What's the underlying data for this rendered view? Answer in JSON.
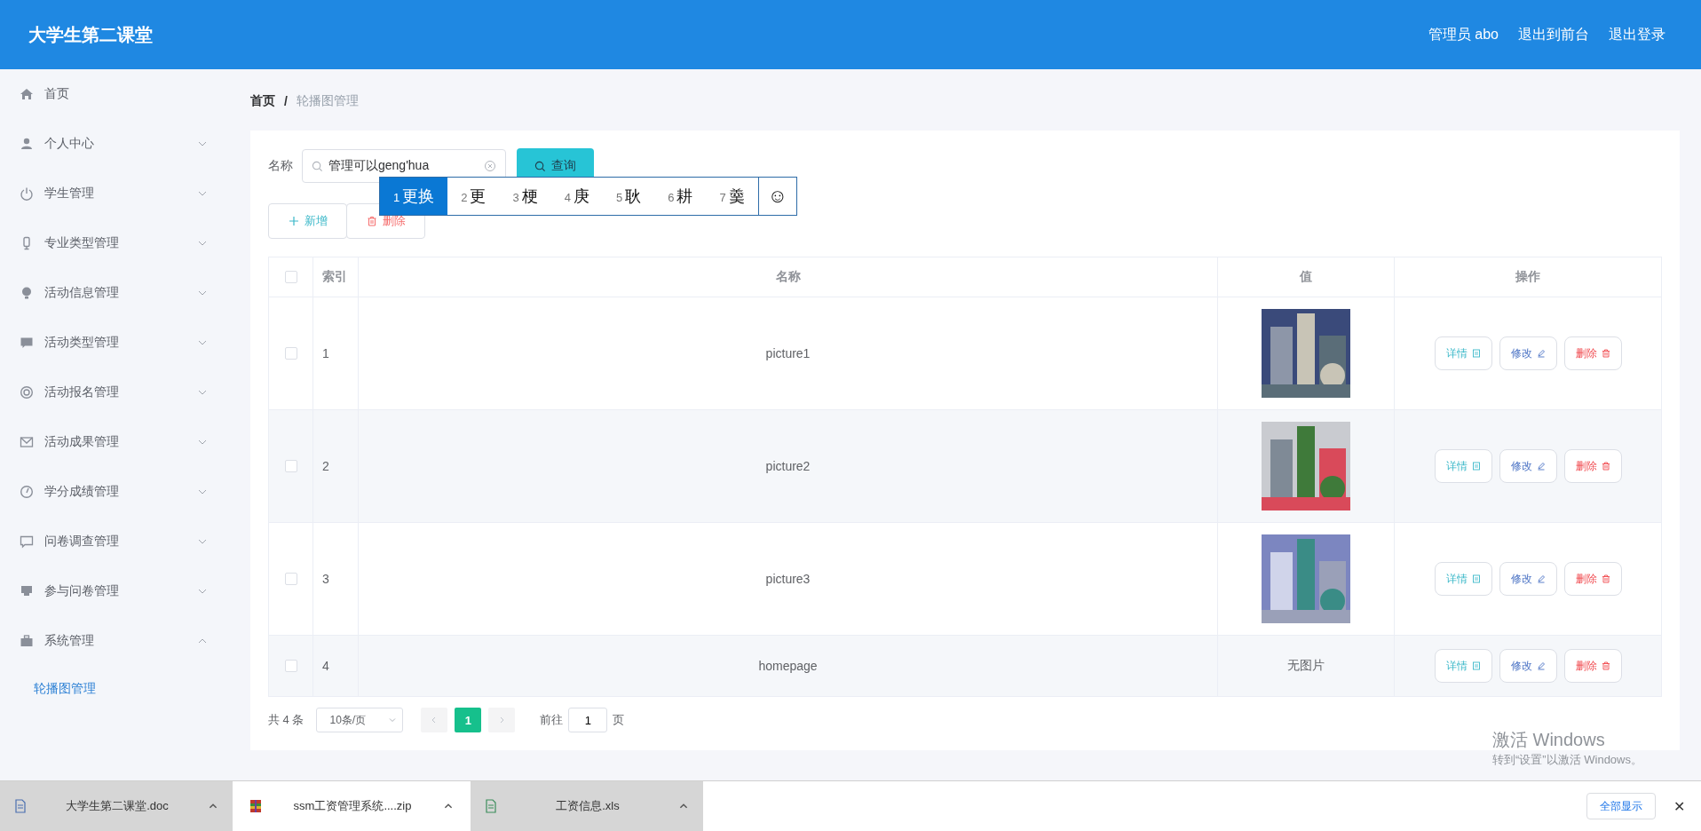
{
  "header": {
    "title": "大学生第二课堂",
    "links": [
      "管理员 abo",
      "退出到前台",
      "退出登录"
    ]
  },
  "sidebar": {
    "items": [
      {
        "label": "首页",
        "selected": false
      },
      {
        "label": "个人中心",
        "expanded": false
      },
      {
        "label": "学生管理",
        "expanded": false
      },
      {
        "label": "专业类型管理",
        "expanded": false
      },
      {
        "label": "活动信息管理",
        "expanded": false
      },
      {
        "label": "活动类型管理",
        "expanded": false
      },
      {
        "label": "活动报名管理",
        "expanded": false
      },
      {
        "label": "活动成果管理",
        "expanded": false
      },
      {
        "label": "学分成绩管理",
        "expanded": false
      },
      {
        "label": "问卷调查管理",
        "expanded": false
      },
      {
        "label": "参与问卷管理",
        "expanded": false
      },
      {
        "label": "系统管理",
        "expanded": true,
        "children": [
          {
            "label": "轮播图管理",
            "selected": true
          }
        ]
      }
    ]
  },
  "breadcrumb": [
    "首页",
    "/",
    "轮播图管理"
  ],
  "search": {
    "label": "名称",
    "value": "管理可以geng'hua",
    "button": "查询"
  },
  "ime": {
    "candidates": [
      {
        "index": "1",
        "text": "更换",
        "selected": true
      },
      {
        "index": "2",
        "text": "更",
        "selected": false
      },
      {
        "index": "3",
        "text": "梗",
        "selected": false
      },
      {
        "index": "4",
        "text": "庚",
        "selected": false
      },
      {
        "index": "5",
        "text": "耿",
        "selected": false
      },
      {
        "index": "6",
        "text": "耕",
        "selected": false
      },
      {
        "index": "7",
        "text": "羹",
        "selected": false
      }
    ],
    "emoji": "☺"
  },
  "actions": [
    "新增",
    "删除"
  ],
  "table": {
    "select_all_checked": false,
    "columns": [
      "索引",
      "名称",
      "值",
      "操作"
    ],
    "rows": [
      {
        "checked": false,
        "index": "1",
        "name": "picture1",
        "value": {
          "kind": "picture"
        },
        "ops": [
          "详情",
          "修改",
          "删除"
        ]
      },
      {
        "checked": false,
        "index": "2",
        "name": "picture2",
        "value": {
          "kind": "picture"
        },
        "ops": [
          "详情",
          "修改",
          "删除"
        ]
      },
      {
        "checked": false,
        "index": "3",
        "name": "picture3",
        "value": {
          "kind": "picture"
        },
        "ops": [
          "详情",
          "修改",
          "删除"
        ]
      },
      {
        "checked": false,
        "index": "4",
        "name": "homepage",
        "value": {
          "kind": "text",
          "text": "无图片"
        },
        "ops": [
          "详情",
          "修改",
          "删除"
        ]
      }
    ]
  },
  "pagination": {
    "total": "共 4 条",
    "page_size": "10条/页",
    "pages": [
      {
        "label": "1",
        "selected": true
      }
    ],
    "goto_label": "前往",
    "goto_value": "1",
    "goto_suffix": "页"
  },
  "activation": {
    "title": "激活 Windows",
    "hint": "转到“设置”以激活 Windows。"
  },
  "downloads": {
    "items": [
      {
        "name": "大学生第二课堂.doc",
        "highlighted": true
      },
      {
        "name": "ssm工资管理系统....zip",
        "highlighted": false
      },
      {
        "name": "工资信息.xls",
        "highlighted": true
      }
    ],
    "show_all": "全部显示",
    "close": "✕"
  }
}
